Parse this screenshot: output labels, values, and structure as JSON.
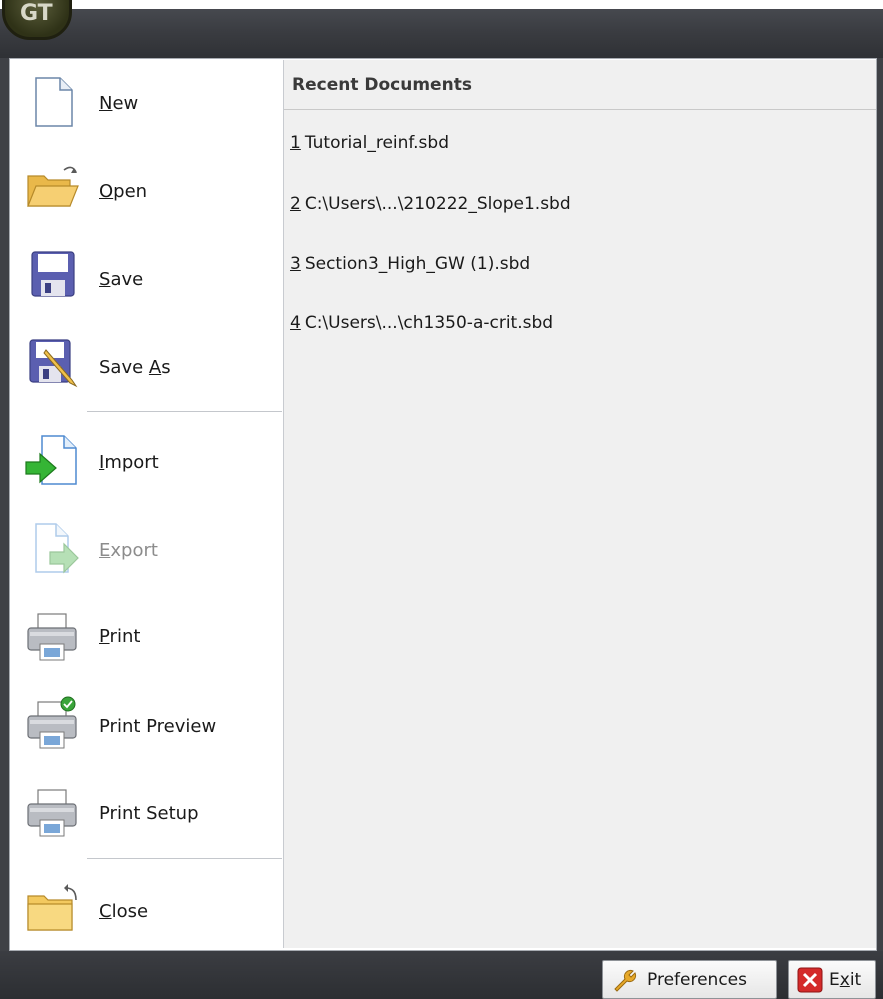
{
  "app": {
    "logo_text": "GT"
  },
  "menu": {
    "items": [
      {
        "id": "new",
        "label": "New",
        "accel": "N",
        "rest": "ew",
        "icon": "new-document-icon",
        "enabled": true
      },
      {
        "id": "open",
        "label": "Open",
        "accel": "O",
        "rest": "pen",
        "icon": "open-folder-icon",
        "enabled": true
      },
      {
        "id": "save",
        "label": "Save",
        "accel": "S",
        "rest": "ave",
        "icon": "floppy-disk-icon",
        "enabled": true
      },
      {
        "id": "save-as",
        "label": "Save As",
        "pre": "Save ",
        "accel": "A",
        "rest": "s",
        "icon": "floppy-pencil-icon",
        "enabled": true
      },
      {
        "id": "import",
        "label": "Import",
        "accel": "I",
        "rest": "mport",
        "icon": "import-arrow-icon",
        "enabled": true
      },
      {
        "id": "export",
        "label": "Export",
        "accel": "E",
        "rest": "xport",
        "icon": "export-arrow-icon",
        "enabled": false
      },
      {
        "id": "print",
        "label": "Print",
        "accel": "P",
        "rest": "rint",
        "icon": "printer-icon",
        "enabled": true
      },
      {
        "id": "print-preview",
        "label": "Print Preview",
        "icon": "printer-check-icon",
        "enabled": true
      },
      {
        "id": "print-setup",
        "label": "Print Setup",
        "icon": "printer-setup-icon",
        "enabled": true
      },
      {
        "id": "close",
        "label": "Close",
        "accel": "C",
        "rest": "lose",
        "icon": "close-folder-icon",
        "enabled": true
      }
    ]
  },
  "recent": {
    "title": "Recent Documents",
    "items": [
      {
        "num": "1",
        "name": "Tutorial_reinf.sbd"
      },
      {
        "num": "2",
        "name": "C:\\Users\\...\\210222_Slope1.sbd"
      },
      {
        "num": "3",
        "name": "Section3_High_GW (1).sbd"
      },
      {
        "num": "4",
        "name": "C:\\Users\\...\\ch1350-a-crit.sbd"
      }
    ]
  },
  "footer": {
    "preferences_label": "Preferences",
    "exit_pre": "E",
    "exit_accel": "x",
    "exit_rest": "it",
    "exit_label": "Exit"
  },
  "colors": {
    "frame_dark": "#3f4146",
    "recent_bg": "#f0f0f0",
    "disabled_text": "#8c8c8c",
    "exit_red": "#d42a2a",
    "import_green": "#2fa82f"
  }
}
